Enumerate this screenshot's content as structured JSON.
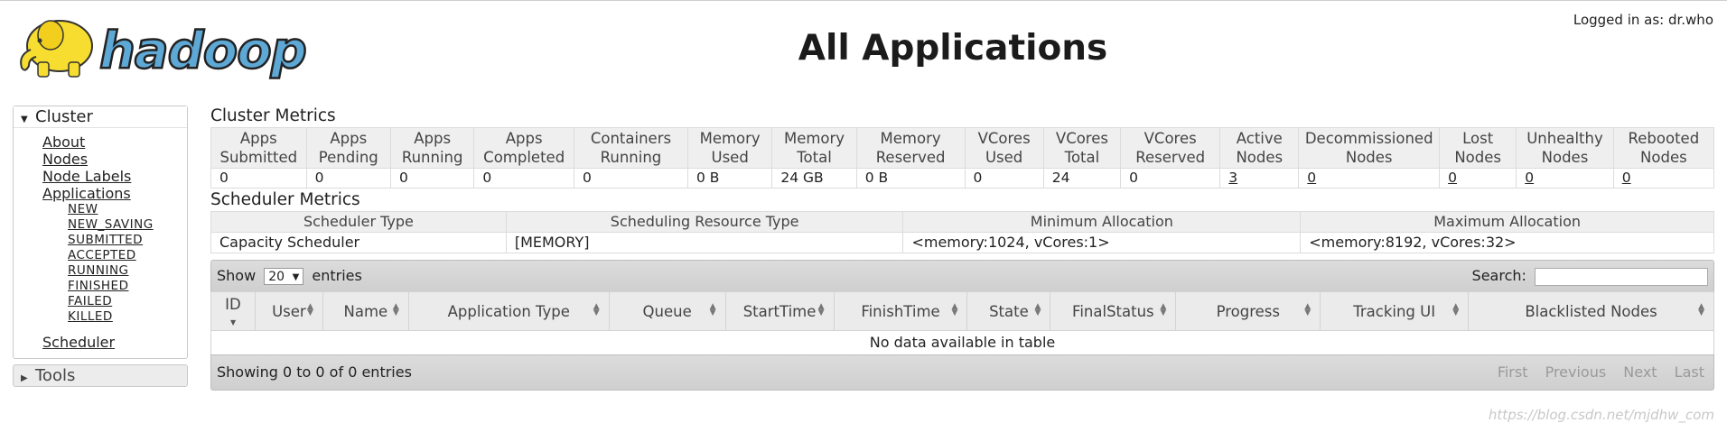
{
  "header": {
    "title": "All Applications",
    "logged_in": "Logged in as: dr.who",
    "logo_text": "hadoop"
  },
  "nav": {
    "cluster": {
      "label": "Cluster",
      "links": [
        "About",
        "Nodes",
        "Node Labels",
        "Applications"
      ],
      "app_states": [
        "NEW",
        "NEW_SAVING",
        "SUBMITTED",
        "ACCEPTED",
        "RUNNING",
        "FINISHED",
        "FAILED",
        "KILLED"
      ],
      "scheduler": "Scheduler"
    },
    "tools": {
      "label": "Tools"
    }
  },
  "cluster_metrics": {
    "title": "Cluster Metrics",
    "headers": [
      [
        "Apps",
        "Submitted"
      ],
      [
        "Apps",
        "Pending"
      ],
      [
        "Apps",
        "Running"
      ],
      [
        "Apps",
        "Completed"
      ],
      [
        "Containers",
        "Running"
      ],
      [
        "Memory",
        "Used"
      ],
      [
        "Memory",
        "Total"
      ],
      [
        "Memory",
        "Reserved"
      ],
      [
        "VCores",
        "Used"
      ],
      [
        "VCores",
        "Total"
      ],
      [
        "VCores",
        "Reserved"
      ],
      [
        "Active",
        "Nodes"
      ],
      [
        "Decommissioned",
        "Nodes"
      ],
      [
        "Lost",
        "Nodes"
      ],
      [
        "Unhealthy",
        "Nodes"
      ],
      [
        "Rebooted",
        "Nodes"
      ]
    ],
    "values": [
      "0",
      "0",
      "0",
      "0",
      "0",
      "0 B",
      "24 GB",
      "0 B",
      "0",
      "24",
      "0",
      "3",
      "0",
      "0",
      "0",
      "0"
    ]
  },
  "scheduler_metrics": {
    "title": "Scheduler Metrics",
    "headers": [
      "Scheduler Type",
      "Scheduling Resource Type",
      "Minimum Allocation",
      "Maximum Allocation"
    ],
    "values": [
      "Capacity Scheduler",
      "[MEMORY]",
      "<memory:1024, vCores:1>",
      "<memory:8192, vCores:32>"
    ]
  },
  "apps_table": {
    "show_label": "Show",
    "page_length": "20",
    "entries_label": "entries",
    "search_label": "Search:",
    "search_value": "",
    "columns": [
      "ID",
      "User",
      "Name",
      "Application Type",
      "Queue",
      "StartTime",
      "FinishTime",
      "State",
      "FinalStatus",
      "Progress",
      "Tracking UI",
      "Blacklisted Nodes"
    ],
    "empty_message": "No data available in table",
    "info": "Showing 0 to 0 of 0 entries",
    "pager": [
      "First",
      "Previous",
      "Next",
      "Last"
    ]
  },
  "watermark": "https://blog.csdn.net/mjdhw_com"
}
